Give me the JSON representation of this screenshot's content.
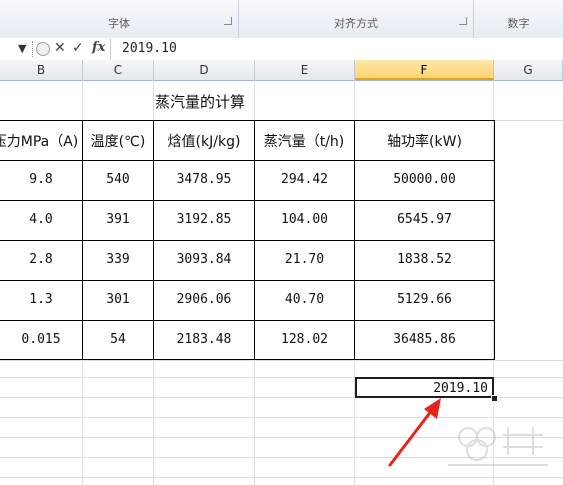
{
  "ribbon": {
    "groups": [
      "字体",
      "对齐方式",
      "数字"
    ]
  },
  "formula_bar": {
    "value": "2019.10"
  },
  "columns": [
    "B",
    "C",
    "D",
    "E",
    "F",
    "G"
  ],
  "active_column": "F",
  "sheet": {
    "title": "蒸汽量的计算",
    "headers": [
      "压力MPa（A)",
      "温度(℃)",
      "焓值(kJ/kg)",
      "蒸汽量（t/h)",
      "轴功率(kW)"
    ],
    "rows": [
      [
        "9.8",
        "540",
        "3478.95",
        "294.42",
        "50000.00"
      ],
      [
        "4.0",
        "391",
        "3192.85",
        "104.00",
        "6545.97"
      ],
      [
        "2.8",
        "339",
        "3093.84",
        "21.70",
        "1838.52"
      ],
      [
        "1.3",
        "301",
        "2906.06",
        "40.70",
        "5129.66"
      ],
      [
        "0.015",
        "54",
        "2183.48",
        "128.02",
        "36485.86"
      ]
    ],
    "selected_cell_value": "2019.10"
  },
  "colors": {
    "active_header": "#fbd472",
    "arrow": "#e8231b",
    "gridline": "#dadfe6"
  }
}
